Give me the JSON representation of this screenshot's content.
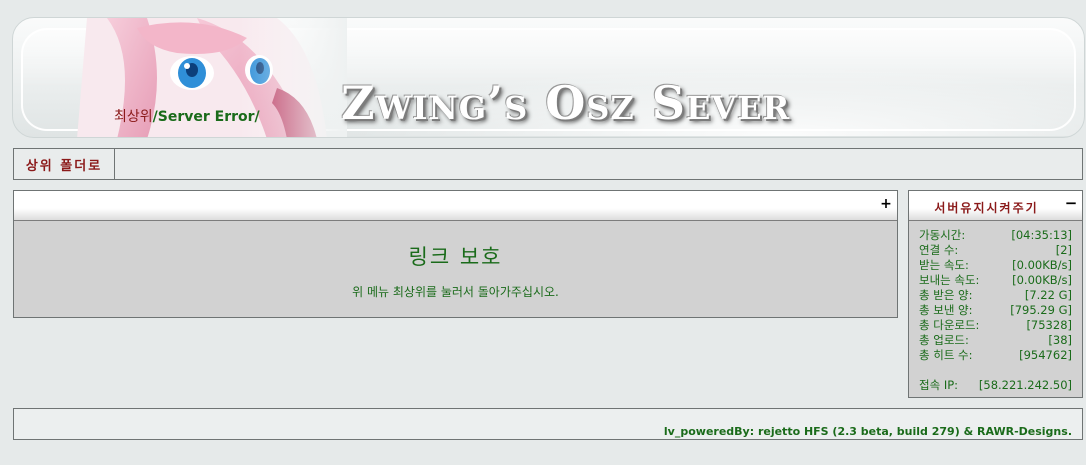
{
  "header": {
    "site_title": "Zwing’s Osz Sever",
    "breadcrumb": {
      "root": "최상위",
      "path": "/Server Error/"
    }
  },
  "toolbar": {
    "up_button": "상위 폴더로"
  },
  "main": {
    "expand_icon": "+",
    "title": "링크 보호",
    "message": "위 메뉴 최상위를 눌러서 돌아가주십시오."
  },
  "status": {
    "title": "서버유지시켜주기",
    "collapse_icon": "−",
    "rows": [
      {
        "label": "가동시간:",
        "value": "[04:35:13]"
      },
      {
        "label": "연결 수:",
        "value": "[2]"
      },
      {
        "label": "받는 속도:",
        "value": "[0.00KB/s]"
      },
      {
        "label": "보내는 속도:",
        "value": "[0.00KB/s]"
      },
      {
        "label": "총 받은 양:",
        "value": "[7.22 G]"
      },
      {
        "label": "총 보낸 양:",
        "value": "[795.29 G]"
      },
      {
        "label": "총 다운로드:",
        "value": "[75328]"
      },
      {
        "label": "총 업로드:",
        "value": "[38]"
      },
      {
        "label": "총 히트 수:",
        "value": "[954762]"
      }
    ],
    "ip_row": {
      "label": "접속 IP:",
      "value": "[58.221.242.50]"
    }
  },
  "footer": {
    "text": "lv_poweredBy: rejetto HFS (2.3 beta, build 279) & RAWR-Designs."
  },
  "colors": {
    "accent_red": "#8b1a1a",
    "text_green": "#1a6b1a",
    "background": "#e6eaea"
  }
}
